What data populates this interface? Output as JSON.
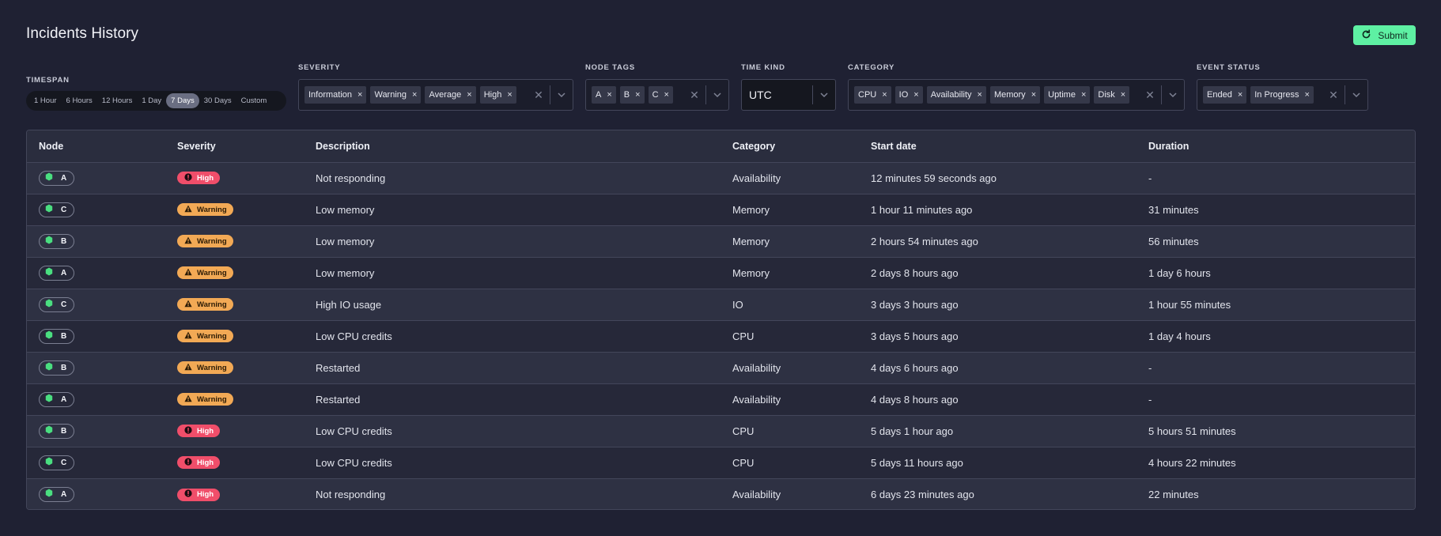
{
  "page": {
    "title": "Incidents History"
  },
  "submit": {
    "label": "Submit"
  },
  "filters": {
    "timespan": {
      "label": "TIMESPAN",
      "options": [
        "1 Hour",
        "6 Hours",
        "12 Hours",
        "1 Day",
        "7 Days",
        "30 Days",
        "Custom"
      ],
      "selected": "7 Days"
    },
    "severity": {
      "label": "SEVERITY",
      "chips": [
        "Information",
        "Warning",
        "Average",
        "High"
      ]
    },
    "node_tags": {
      "label": "NODE TAGS",
      "chips": [
        "A",
        "B",
        "C"
      ]
    },
    "time_kind": {
      "label": "TIME KIND",
      "value": "UTC"
    },
    "category": {
      "label": "CATEGORY",
      "chips": [
        "CPU",
        "IO",
        "Availability",
        "Memory",
        "Uptime",
        "Disk"
      ]
    },
    "event_status": {
      "label": "EVENT STATUS",
      "chips": [
        "Ended",
        "In Progress"
      ]
    }
  },
  "table": {
    "columns": [
      "Node",
      "Severity",
      "Description",
      "Category",
      "Start date",
      "Duration"
    ],
    "rows": [
      {
        "node": "A",
        "severity": "High",
        "description": "Not responding",
        "category": "Availability",
        "start": "12 minutes 59 seconds ago",
        "duration": "-"
      },
      {
        "node": "C",
        "severity": "Warning",
        "description": "Low memory",
        "category": "Memory",
        "start": "1 hour 11 minutes ago",
        "duration": "31 minutes"
      },
      {
        "node": "B",
        "severity": "Warning",
        "description": "Low memory",
        "category": "Memory",
        "start": "2 hours 54 minutes ago",
        "duration": "56 minutes"
      },
      {
        "node": "A",
        "severity": "Warning",
        "description": "Low memory",
        "category": "Memory",
        "start": "2 days 8 hours ago",
        "duration": "1 day 6 hours"
      },
      {
        "node": "C",
        "severity": "Warning",
        "description": "High IO usage",
        "category": "IO",
        "start": "3 days 3 hours ago",
        "duration": "1 hour 55 minutes"
      },
      {
        "node": "B",
        "severity": "Warning",
        "description": "Low CPU credits",
        "category": "CPU",
        "start": "3 days 5 hours ago",
        "duration": "1 day 4 hours"
      },
      {
        "node": "B",
        "severity": "Warning",
        "description": "Restarted",
        "category": "Availability",
        "start": "4 days 6 hours ago",
        "duration": "-"
      },
      {
        "node": "A",
        "severity": "Warning",
        "description": "Restarted",
        "category": "Availability",
        "start": "4 days 8 hours ago",
        "duration": "-"
      },
      {
        "node": "B",
        "severity": "High",
        "description": "Low CPU credits",
        "category": "CPU",
        "start": "5 days 1 hour ago",
        "duration": "5 hours 51 minutes"
      },
      {
        "node": "C",
        "severity": "High",
        "description": "Low CPU credits",
        "category": "CPU",
        "start": "5 days 11 hours ago",
        "duration": "4 hours 22 minutes"
      },
      {
        "node": "A",
        "severity": "High",
        "description": "Not responding",
        "category": "Availability",
        "start": "6 days 23 minutes ago",
        "duration": "22 minutes"
      }
    ]
  },
  "colors": {
    "background": "#1f2133",
    "accent": "#5ef0a3",
    "high": "#f04e6a",
    "warning": "#f2a955",
    "node_icon": "#4ade80"
  },
  "icons": {
    "submit": "refresh-icon",
    "node": "hexagon-icon",
    "high": "exclamation-circle-icon",
    "warning": "warning-triangle-icon",
    "chip_remove": "close-icon",
    "select_arrow": "chevron-down-icon"
  }
}
